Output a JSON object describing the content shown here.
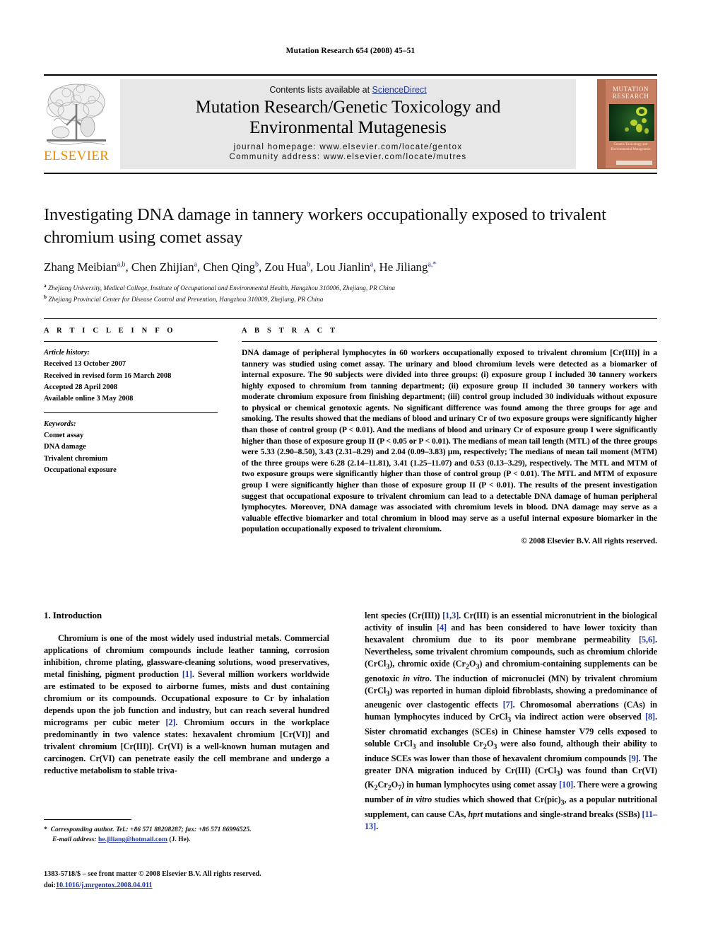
{
  "running_head": "Mutation Research 654 (2008) 45–51",
  "masthead": {
    "contents_prefix": "Contents lists available at ",
    "sciencedirect": "ScienceDirect",
    "journal_title_line1": "Mutation Research/Genetic Toxicology and",
    "journal_title_line2": "Environmental Mutagenesis",
    "homepage": "journal homepage: www.elsevier.com/locate/gentox",
    "community": "Community address: www.elsevier.com/locate/mutres",
    "publisher_logo_text": "ELSEVIER",
    "publisher_logo_color": "#ED8B00",
    "sciencedirect_color": "#2a3f93",
    "cover": {
      "title_line1": "MUTATION",
      "title_line2": "RESEARCH",
      "subtitle_line1": "Genetic Toxicology and",
      "subtitle_line2": "Environmental Mutagenesis",
      "background_color": "#c97f61"
    }
  },
  "article": {
    "title": "Investigating DNA damage in tannery workers occupationally exposed to trivalent chromium using comet assay",
    "authors_html": "Zhang Meibian<sup>a,b</sup>, Chen Zhijian<sup>a</sup>, Chen Qing<sup>b</sup>, Zou Hua<sup>b</sup>, Lou Jianlin<sup>a</sup>, He Jiliang<sup>a,*</sup>",
    "affiliation_a": "Zhejiang University, Medical College, Institute of Occupational and Environmental Health, Hangzhou 310006, Zhejiang, PR China",
    "affiliation_b": "Zhejiang Provincial Center for Disease Control and Prevention, Hangzhou 310009, Zhejiang, PR China"
  },
  "article_info": {
    "heading": "A R T I C L E   I N F O",
    "history_label": "Article history:",
    "history": [
      "Received 13 October 2007",
      "Received in revised form 16 March 2008",
      "Accepted 28 April 2008",
      "Available online 3 May 2008"
    ],
    "keywords_label": "Keywords:",
    "keywords": [
      "Comet assay",
      "DNA damage",
      "Trivalent chromium",
      "Occupational exposure"
    ]
  },
  "abstract": {
    "heading": "A B S T R A C T",
    "text": "DNA damage of peripheral lymphocytes in 60 workers occupationally exposed to trivalent chromium [Cr(III)] in a tannery was studied using comet assay. The urinary and blood chromium levels were detected as a biomarker of internal exposure. The 90 subjects were divided into three groups: (i) exposure group I included 30 tannery workers highly exposed to chromium from tanning department; (ii) exposure group II included 30 tannery workers with moderate chromium exposure from finishing department; (iii) control group included 30 individuals without exposure to physical or chemical genotoxic agents. No significant difference was found among the three groups for age and smoking. The results showed that the medians of blood and urinary Cr of two exposure groups were significantly higher than those of control group (P < 0.01). And the medians of blood and urinary Cr of exposure group I were significantly higher than those of exposure group II (P < 0.05 or P < 0.01). The medians of mean tail length (MTL) of the three groups were 5.33 (2.90–8.50), 3.43 (2.31–8.29) and 2.04 (0.09–3.83) μm, respectively; The medians of mean tail moment (MTM) of the three groups were 6.28 (2.14–11.81), 3.41 (1.25–11.07) and 0.53 (0.13–3.29), respectively. The MTL and MTM of two exposure groups were significantly higher than those of control group (P < 0.01). The MTL and MTM of exposure group I were significantly higher than those of exposure group II (P < 0.01). The results of the present investigation suggest that occupational exposure to trivalent chromium can lead to a detectable DNA damage of human peripheral lymphocytes. Moreover, DNA damage was associated with chromium levels in blood. DNA damage may serve as a valuable effective biomarker and total chromium in blood may serve as a useful internal exposure biomarker in the population occupationally exposed to trivalent chromium.",
    "copyright": "© 2008 Elsevier B.V. All rights reserved."
  },
  "introduction": {
    "heading": "1.  Introduction",
    "left_html": "Chromium is one of the most widely used industrial metals. Commercial applications of chromium compounds include leather tanning, corrosion inhibition, chrome plating, glassware-cleaning solutions, wood preservatives, metal finishing, pigment production <span class=\"ref\">[1]</span>. Several million workers worldwide are estimated to be exposed to airborne fumes, mists and dust containing chromium or its compounds. Occupational exposure to Cr by inhalation depends upon the job function and industry, but can reach several hundred micrograms per cubic meter <span class=\"ref\">[2]</span>. Chromium occurs in the workplace predominantly in two valence states: hexavalent chromium [Cr(VI)] and trivalent chromium [Cr(III)]. Cr(VI) is a well-known human mutagen and carcinogen. Cr(VI) can penetrate easily the cell membrane and undergo a reductive metabolism to stable triva-",
    "right_html": "lent species (Cr(III)) <span class=\"ref\">[1,3]</span>. Cr(III) is an essential micronutrient in the biological activity of insulin <span class=\"ref\">[4]</span> and has been considered to have lower toxicity than hexavalent chromium due to its poor membrane permeability <span class=\"ref\">[5,6]</span>. Nevertheless, some trivalent chromium compounds, such as chromium chloride (CrCl<sub>3</sub>), chromic oxide (Cr<sub>2</sub>O<sub>3</sub>) and chromium-containing supplements can be genotoxic <span class=\"ital\">in vitro</span>. The induction of micronuclei (MN) by trivalent chromium (CrCl<sub>3</sub>) was reported in human diploid fibroblasts, showing a predominance of aneugenic over clastogentic effects <span class=\"ref\">[7]</span>. Chromosomal aberrations (CAs) in human lymphocytes induced by CrCl<sub>3</sub> via indirect action were observed <span class=\"ref\">[8]</span>. Sister chromatid exchanges (SCEs) in Chinese hamster V79 cells exposed to soluble CrCl<sub>3</sub> and insoluble Cr<sub>2</sub>O<sub>3</sub> were also found, although their ability to induce SCEs was lower than those of hexavalent chromium compounds <span class=\"ref\">[9]</span>. The greater DNA migration induced by Cr(III) (CrCl<sub>3</sub>) was found than Cr(VI) (K<sub>2</sub>Cr<sub>2</sub>O<sub>7</sub>) in human lymphocytes using comet assay <span class=\"ref\">[10]</span>. There were a growing number of <span class=\"ital\">in vitro</span> studies which showed that Cr(pic)<sub>3</sub>, as a popular nutritional supplement, can cause CAs, <span class=\"ital\">hprt</span> mutations and single-strand breaks (SSBs) <span class=\"ref\">[11–13]</span>."
  },
  "footer": {
    "corresponding_html": "<span class=\"star\">*</span>&nbsp; Corresponding author. Tel.: +86 571 88208287; fax: +86 571 86996525.",
    "email_label": "E-mail address:",
    "email": "he.jiliang@hotmail.com",
    "email_suffix": "(J. He).",
    "issn_line": "1383-5718/$ – see front matter © 2008 Elsevier B.V. All rights reserved.",
    "doi_label": "doi:",
    "doi": "10.1016/j.mrgentox.2008.04.011"
  }
}
